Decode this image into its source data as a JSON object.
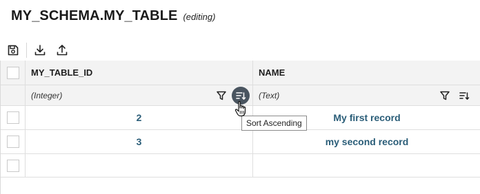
{
  "header": {
    "title": "MY_SCHEMA.MY_TABLE",
    "mode": "(editing)"
  },
  "toolbar": {
    "buttons": [
      "save-icon",
      "download-icon",
      "upload-icon"
    ]
  },
  "columns": [
    {
      "name": "MY_TABLE_ID",
      "type": "(Integer)"
    },
    {
      "name": "NAME",
      "type": "(Text)"
    }
  ],
  "rows": [
    {
      "id": "2",
      "name": "My first record"
    },
    {
      "id": "3",
      "name": "my second record"
    },
    {
      "id": "",
      "name": ""
    }
  ],
  "tooltip": "Sort Ascending",
  "colors": {
    "value_text": "#2a5d78",
    "active_sort_button": "#4a5560",
    "header_bg": "#f3f3f3"
  }
}
